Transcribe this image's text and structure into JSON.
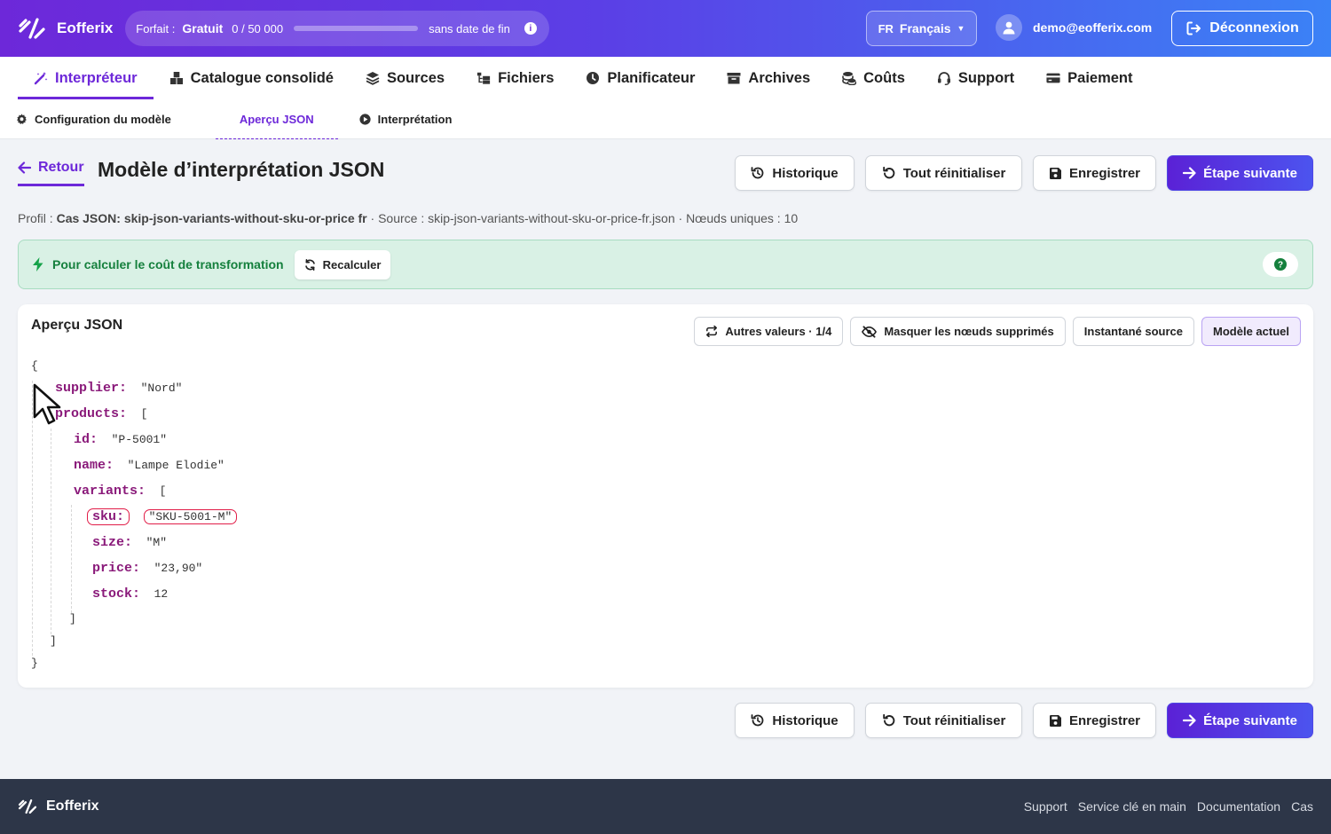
{
  "colors": {
    "accent": "#6d28d9",
    "header_gradient": [
      "#6d28d9",
      "#3b82f6"
    ],
    "alert_bg": "#d9f1e5",
    "alert_text": "#15803d",
    "json_key": "#8a1a7a",
    "highlight": "#e11d48",
    "footer_bg": "#2d3648"
  },
  "header": {
    "brand": "Eofferix",
    "brand_icon": "slash-logo-icon",
    "plan_label": "Forfait :",
    "plan_name": "Gratuit",
    "usage": "0 / 50 000",
    "usage_fraction": 0,
    "plan_expiry": "sans date de fin",
    "info_icon": "info-icon",
    "lang_code": "FR",
    "lang_label": "Français",
    "user_email": "demo@eofferix.com",
    "logout_label": "Déconnexion"
  },
  "main_nav": [
    {
      "label": "Interpréteur",
      "icon": "magic-wand-icon",
      "active": true
    },
    {
      "label": "Catalogue consolidé",
      "icon": "boxes-icon",
      "active": false
    },
    {
      "label": "Sources",
      "icon": "layers-icon",
      "active": false
    },
    {
      "label": "Fichiers",
      "icon": "folder-tree-icon",
      "active": false
    },
    {
      "label": "Planificateur",
      "icon": "clock-icon",
      "active": false
    },
    {
      "label": "Archives",
      "icon": "archive-icon",
      "active": false
    },
    {
      "label": "Coûts",
      "icon": "coins-icon",
      "active": false
    },
    {
      "label": "Support",
      "icon": "headset-icon",
      "active": false
    },
    {
      "label": "Paiement",
      "icon": "credit-card-icon",
      "active": false
    }
  ],
  "sub_nav": [
    {
      "label": "Configuration du modèle",
      "icon": "gear-icon",
      "active": false
    },
    {
      "label": "Aperçu JSON",
      "icon": "",
      "active": true
    },
    {
      "label": "Interprétation",
      "icon": "play-circle-icon",
      "active": false
    }
  ],
  "page": {
    "back_label": "Retour",
    "title": "Modèle d’interprétation JSON",
    "meta_profile_label": "Profil :",
    "meta_profile_value": "Cas JSON: skip-json-variants-without-sku-or-price fr",
    "meta_rest": "· Source : skip-json-variants-without-sku-or-price-fr.json · Nœuds uniques : 10"
  },
  "actions": {
    "history": "Historique",
    "reset": "Tout réinitialiser",
    "save": "Enregistrer",
    "next": "Étape suivante"
  },
  "alert": {
    "icon": "bolt-icon",
    "text": "Pour calculer le coût de transformation",
    "recalc_label": "Recalculer",
    "help_icon": "question-icon"
  },
  "preview": {
    "title": "Aperçu JSON",
    "other_values": "Autres valeurs · 1/4",
    "hide_deleted": "Masquer les nœuds supprimés",
    "source_snapshot": "Instantané source",
    "current_model": "Modèle actuel",
    "json_lines": [
      {
        "indent": 0,
        "key": "",
        "value": "{"
      },
      {
        "indent": 1,
        "key": "supplier:",
        "value": "\"Nord\""
      },
      {
        "indent": 1,
        "key": "products:",
        "value": "["
      },
      {
        "indent": 2,
        "key": "id:",
        "value": "\"P-5001\""
      },
      {
        "indent": 2,
        "key": "name:",
        "value": "\"Lampe Elodie\""
      },
      {
        "indent": 2,
        "key": "variants:",
        "value": "["
      },
      {
        "indent": 3,
        "key": "sku:",
        "value": "\"SKU-5001-M\"",
        "highlight": true
      },
      {
        "indent": 3,
        "key": "size:",
        "value": "\"M\""
      },
      {
        "indent": 3,
        "key": "price:",
        "value": "\"23,90\""
      },
      {
        "indent": 3,
        "key": "stock:",
        "value": "12"
      },
      {
        "indent": 2,
        "key": "",
        "value": "]"
      },
      {
        "indent": 1,
        "key": "",
        "value": "]"
      },
      {
        "indent": 0,
        "key": "",
        "value": "}"
      }
    ]
  },
  "footer": {
    "brand": "Eofferix",
    "links": [
      "Support",
      "Service clé en main",
      "Documentation",
      "Cas"
    ]
  }
}
